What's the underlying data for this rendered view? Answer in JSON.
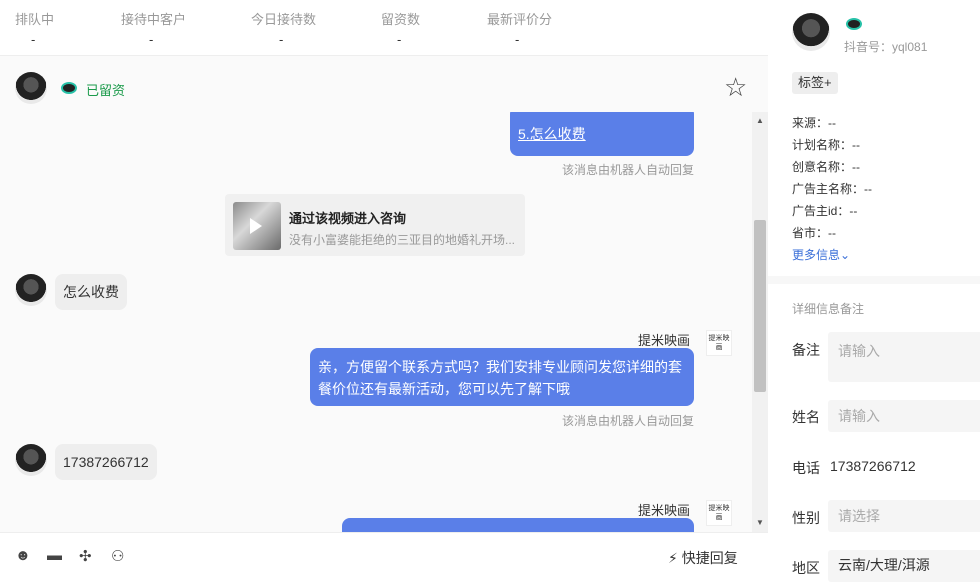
{
  "stats": [
    {
      "label": "排队中",
      "value": "-"
    },
    {
      "label": "接待中客户",
      "value": "-"
    },
    {
      "label": "今日接待数",
      "value": "-"
    },
    {
      "label": "留资数",
      "value": "-"
    },
    {
      "label": "最新评价分",
      "value": "-"
    }
  ],
  "chat": {
    "status_tag": "已留资",
    "messages": {
      "faq_partial": "5.怎么收费",
      "auto_note": "该消息由机器人自动回复",
      "video_title": "通过该视频进入咨询",
      "video_sub": "没有小富婆能拒绝的三亚目的地婚礼开场...",
      "user_msg1": "怎么收费",
      "sender_name": "提米映画",
      "brand_text": "提米映画",
      "bot_msg": "亲，方便留个联系方式吗？我们安排专业顾问发您详细的套餐价位还有最新活动，您可以先了解下哦",
      "user_msg2": "17387266712"
    }
  },
  "toolbar": {
    "quick_reply": "快捷回复",
    "icons": [
      "emoji-icon",
      "folder-icon",
      "pinwheel-icon",
      "users-icon"
    ]
  },
  "profile": {
    "douyin_id": "抖音号：yql081",
    "tag_button": "标签+",
    "info": [
      "来源：--",
      "计划名称：--",
      "创意名称：--",
      "广告主名称：--",
      "广告主id：--",
      "省市：--"
    ],
    "more_info": "更多信息⌄",
    "detail_title": "详细信息备注",
    "fields": {
      "remark_label": "备注",
      "remark_placeholder": "请输入",
      "name_label": "姓名",
      "name_placeholder": "请输入",
      "phone_label": "电话",
      "phone_value": "17387266712",
      "gender_label": "性别",
      "gender_placeholder": "请选择",
      "region_label": "地区",
      "region_value": "云南/大理/洱源"
    }
  },
  "colors": {
    "accent_blue": "#5a7fe8",
    "kept_green": "#1a9a4a",
    "link_blue": "#3a6fd8"
  }
}
